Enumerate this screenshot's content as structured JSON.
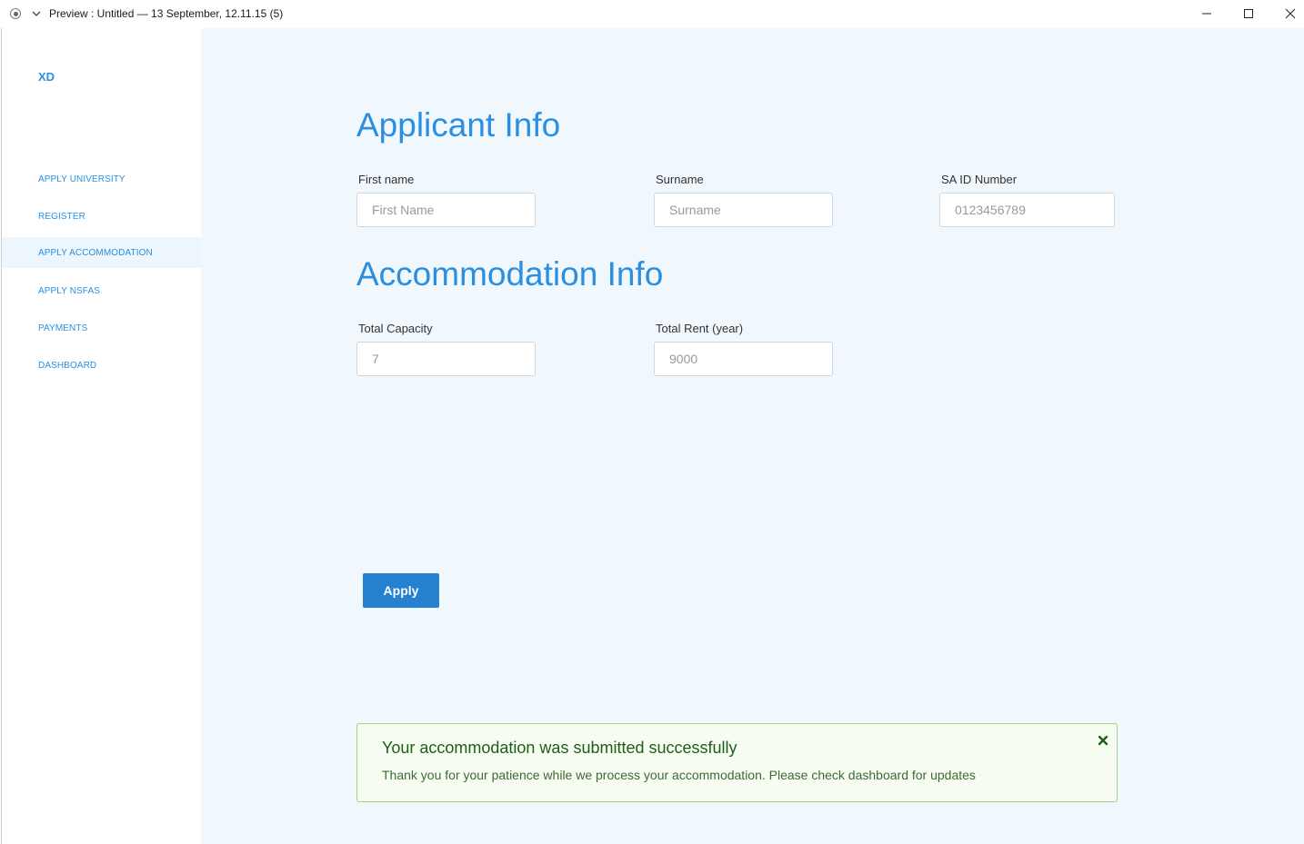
{
  "window": {
    "title": "Preview : Untitled — 13 September, 12.11.15 (5)",
    "icons": [
      "record-icon",
      "chevron-down-icon",
      "minimize-icon",
      "maximize-icon",
      "close-icon"
    ]
  },
  "sidebar": {
    "brand": "XD",
    "items": [
      {
        "label": "APPLY UNIVERSITY",
        "active": false
      },
      {
        "label": "REGISTER",
        "active": false
      },
      {
        "label": "APPLY ACCOMMODATION",
        "active": true
      },
      {
        "label": "APPLY NSFAS",
        "active": false
      },
      {
        "label": "PAYMENTS",
        "active": false
      },
      {
        "label": "DASHBOARD",
        "active": false
      }
    ]
  },
  "applicant": {
    "title": "Applicant Info",
    "first_name": {
      "label": "First name",
      "placeholder": "First Name",
      "value": ""
    },
    "surname": {
      "label": "Surname",
      "placeholder": "Surname",
      "value": ""
    },
    "id_number": {
      "label": "SA ID Number",
      "placeholder": "0123456789",
      "value": ""
    }
  },
  "accommodation": {
    "title": "Accommodation Info",
    "capacity": {
      "label": "Total Capacity",
      "placeholder": "7",
      "value": ""
    },
    "rent": {
      "label": "Total Rent (year)",
      "placeholder": "9000",
      "value": ""
    }
  },
  "actions": {
    "apply_label": "Apply"
  },
  "alert": {
    "title": "Your accommodation was submitted successfully",
    "message": "Thank you for your patience while we process your accommodation. Please check dashboard for updates"
  },
  "colors": {
    "accent": "#2a8fe0",
    "button": "#2580d0",
    "main_bg": "#f0f7fd",
    "alert_bg": "#f6fcf0",
    "alert_border": "#a6cf8e",
    "alert_title": "#1e5d1a"
  }
}
